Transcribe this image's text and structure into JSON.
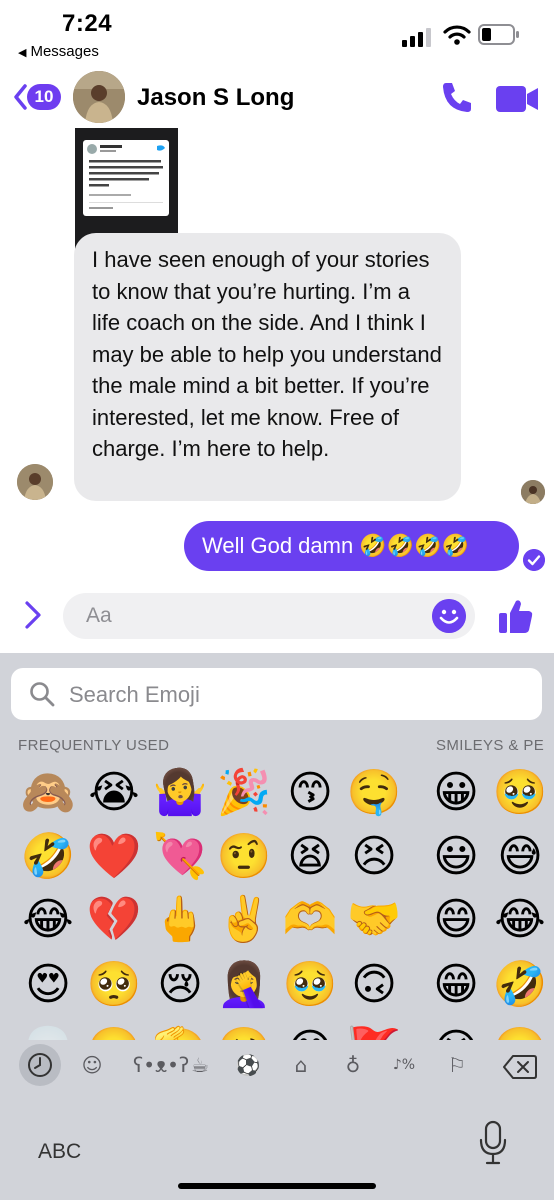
{
  "status_bar": {
    "time": "7:24",
    "back_app": "Messages"
  },
  "header": {
    "unread_count": "10",
    "contact_name": "Jason S Long",
    "accent_color": "#6a40f0"
  },
  "messages": {
    "incoming_image": "tweet-screenshot",
    "incoming_text": "I have seen enough of your stories to know that you’re hurting. I’m a life coach on the side. And I think I may be able to help you understand the male mind a bit better. If you’re interested, let me know. Free of charge. I’m here to help.",
    "outgoing_text": "Well God damn 🤣🤣🤣🤣"
  },
  "composer": {
    "placeholder": "Aa"
  },
  "keyboard": {
    "search_placeholder": "Search Emoji",
    "category_frequent": "FREQUENTLY USED",
    "category_smileys": "SMILEYS & PE",
    "frequent_rows": [
      [
        "🙈",
        "😭",
        "🤷‍♀️",
        "🎉",
        "😙",
        "🤤"
      ],
      [
        "🤣",
        "❤️",
        "💘",
        "🤨",
        "😫",
        "😣"
      ],
      [
        "😂",
        "💔",
        "🖕",
        "✌️",
        "🫶",
        "🤝"
      ],
      [
        "😍",
        "🥺",
        "😢",
        "🤦‍♀️",
        "🥹",
        "🙃"
      ],
      [
        "💀",
        "🥲",
        "🫡",
        "🥴",
        "😅",
        "🚩"
      ]
    ],
    "smiley_rows": [
      [
        "😀",
        "🥹"
      ],
      [
        "😃",
        "😅"
      ],
      [
        "😄",
        "😂"
      ],
      [
        "😁",
        "🤣"
      ],
      [
        "😆",
        "🥲"
      ]
    ],
    "abc_label": "ABC",
    "category_icons": [
      "clock-icon",
      "smiley-icon",
      "bear-icon",
      "food-icon",
      "ball-icon",
      "building-icon",
      "bulb-icon",
      "symbols-icon",
      "flag-icon"
    ]
  }
}
